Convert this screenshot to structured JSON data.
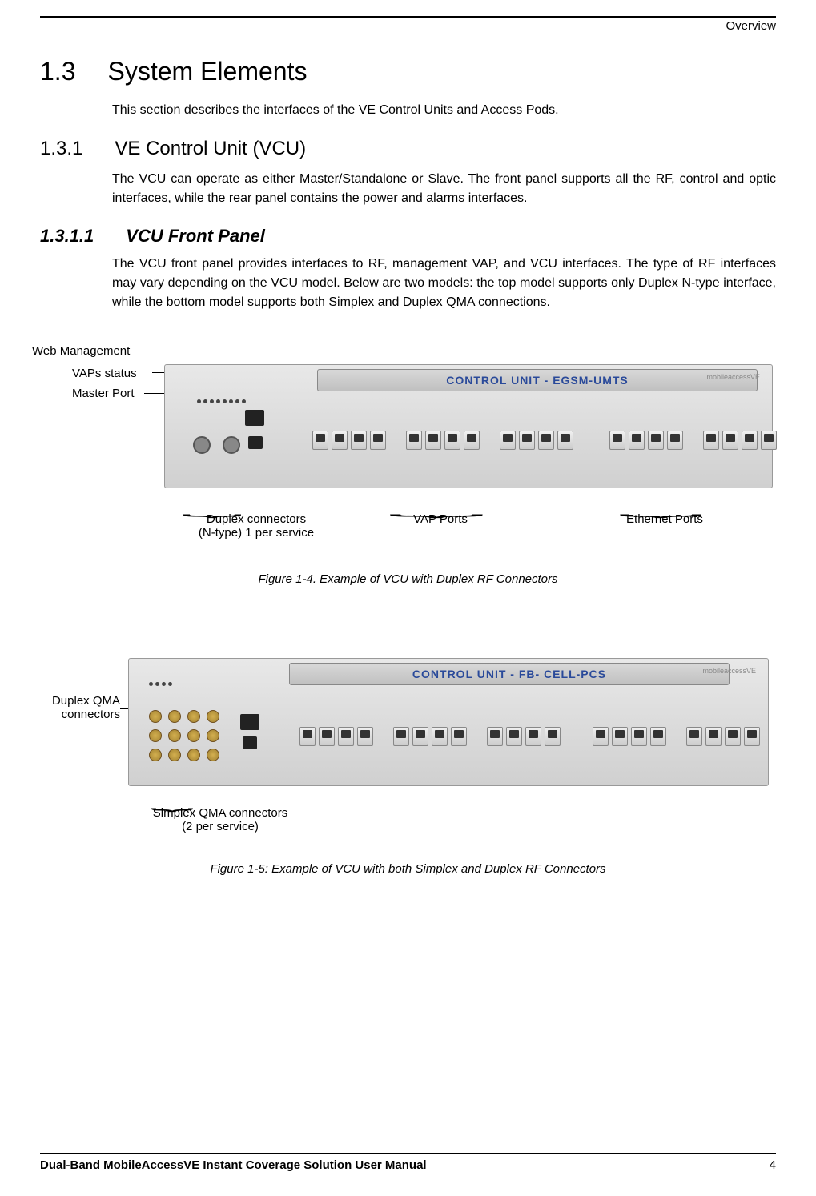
{
  "header": {
    "right_text": "Overview"
  },
  "section": {
    "number": "1.3",
    "title": "System Elements",
    "intro": "This section describes the interfaces of the VE Control Units and Access Pods."
  },
  "subsection": {
    "number": "1.3.1",
    "title": "VE Control Unit (VCU)",
    "text": "The VCU can operate as either Master/Standalone or Slave. The front panel supports all the RF, control and optic interfaces, while the rear panel contains the power and alarms interfaces."
  },
  "subsubsection": {
    "number": "1.3.1.1",
    "title": "VCU Front Panel",
    "text": "The VCU front panel provides interfaces to RF, management VAP, and VCU interfaces. The type of RF interfaces may vary depending on the VCU model. Below are two models: the top model supports only Duplex N-type interface, while the bottom model supports both Simplex and Duplex QMA connections."
  },
  "figure1": {
    "device_title": "CONTROL UNIT - EGSM-UMTS",
    "logo": "mobileaccessVE",
    "callouts": {
      "web_management": "Web Management",
      "vaps_status": "VAPs status",
      "master_port": "Master Port",
      "duplex_connectors_line1": "Duplex connectors",
      "duplex_connectors_line2": "(N-type) 1 per service",
      "vap_ports": "VAP Ports",
      "ethernet_ports": "Ethernet Ports"
    },
    "caption": "Figure 1-4. Example of VCU with Duplex RF Connectors"
  },
  "figure2": {
    "device_title": "CONTROL UNIT - FB- CELL-PCS",
    "logo": "mobileaccessVE",
    "callouts": {
      "duplex_qma_line1": "Duplex QMA",
      "duplex_qma_line2": "connectors",
      "simplex_qma_line1": "Simplex QMA connectors",
      "simplex_qma_line2": "(2 per service)"
    },
    "caption": "Figure 1-5: Example of VCU with both Simplex and Duplex RF Connectors"
  },
  "footer": {
    "title": "Dual-Band MobileAccessVE Instant Coverage Solution User Manual",
    "page": "4"
  }
}
